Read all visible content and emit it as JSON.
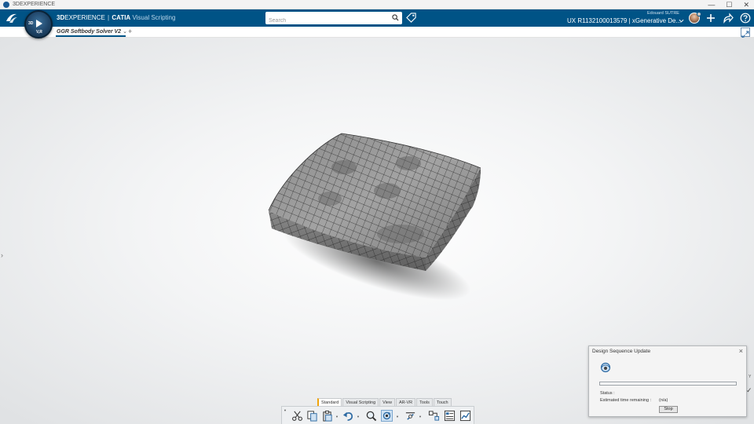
{
  "os": {
    "title": "3DEXPERIENCE",
    "controls": [
      "—",
      "☐",
      "✕"
    ]
  },
  "header": {
    "brand_3d": "3D",
    "brand_experience": "EXPERIENCE",
    "brand_sep": "|",
    "brand_catia": "CATIA",
    "brand_app": "Visual Scripting",
    "compass_3d": "3D",
    "compass_vr": "V,R",
    "search_placeholder": "Search",
    "user_name": "Edouard SUTRE",
    "context": "UX R1132100013579 | xGenerative De...",
    "accent": "#005386"
  },
  "tabbar": {
    "tab_label": "GGR Softbody Solver V2",
    "tab_caret": "⌄",
    "add_label": "+"
  },
  "viewport": {
    "side_arrow": "›"
  },
  "toolbar": {
    "tabs": [
      "Standard",
      "Visual Scripting",
      "View",
      "AR-VR",
      "Tools",
      "Touch"
    ],
    "active_tab": "Standard"
  },
  "dialog": {
    "title": "Design Sequence Update",
    "close": "×",
    "status_label": "Status :",
    "status_value": "",
    "est_label": "Estimated time remaining :",
    "est_value": "(n/a)",
    "stop_label": "Stop",
    "progress": 0
  },
  "axis": {
    "y": "Y",
    "check": "✓"
  }
}
